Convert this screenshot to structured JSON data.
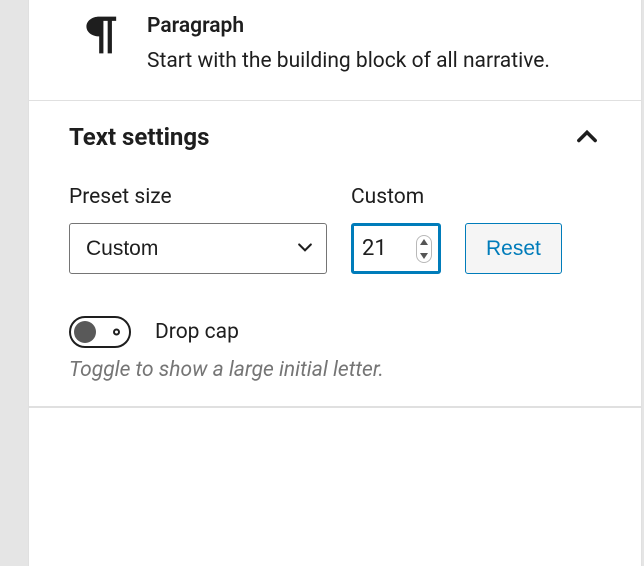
{
  "block": {
    "title": "Paragraph",
    "description": "Start with the building block of all narrative."
  },
  "panel": {
    "title": "Text settings",
    "preset": {
      "label": "Preset size",
      "value": "Custom"
    },
    "custom": {
      "label": "Custom",
      "value": "21"
    },
    "reset": {
      "label": "Reset"
    },
    "dropcap": {
      "label": "Drop cap",
      "hint": "Toggle to show a large initial letter.",
      "enabled": false
    }
  }
}
